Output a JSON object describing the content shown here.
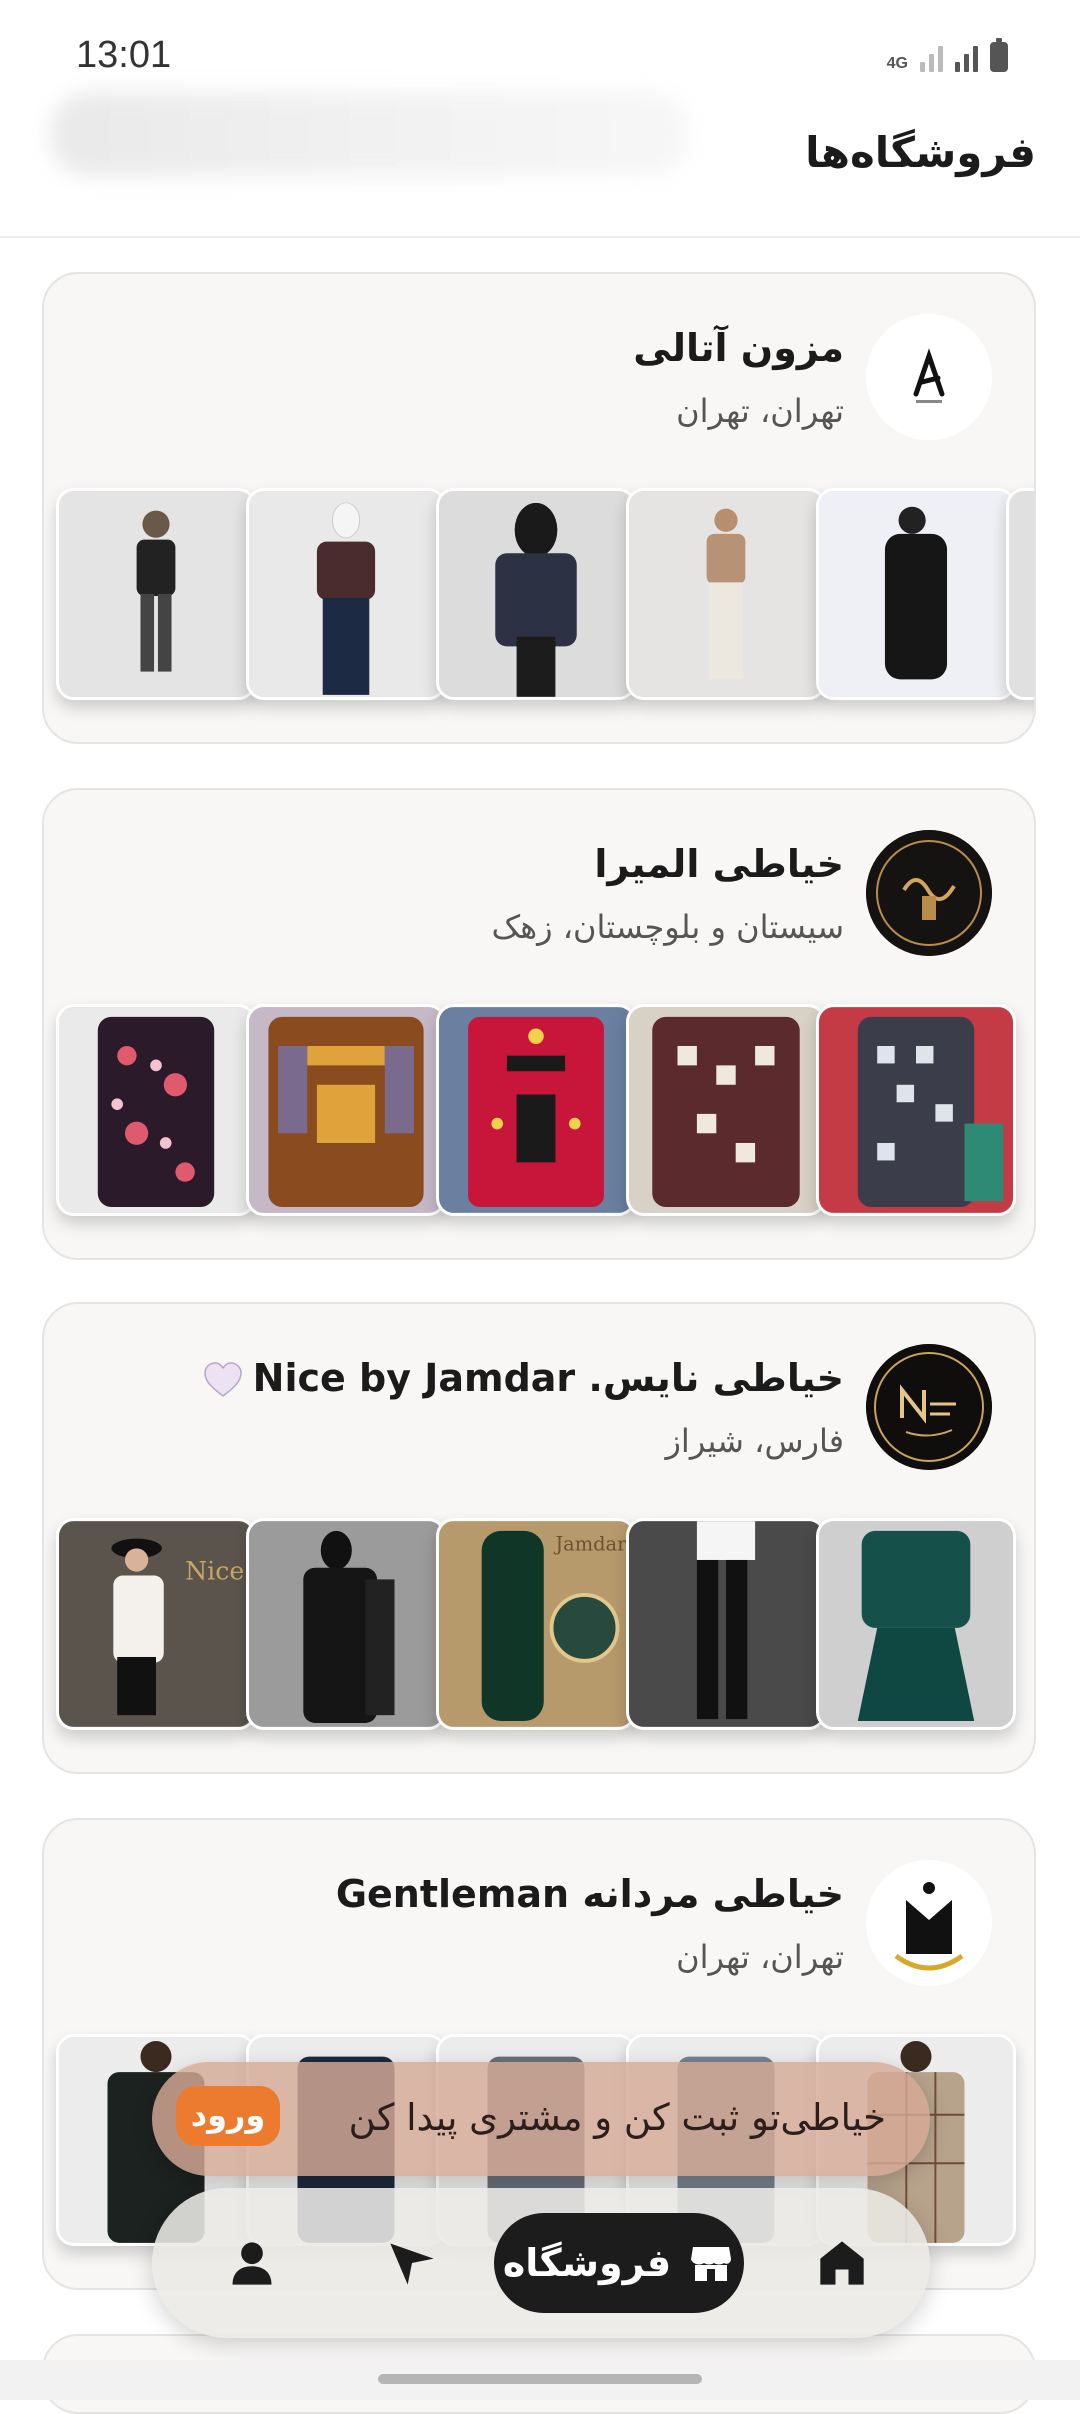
{
  "status_bar": {
    "time": "13:01",
    "network": "4G"
  },
  "header": {
    "title": "فروشگاه‌ها"
  },
  "stores": [
    {
      "name": "مزون آتالی",
      "location": "تهران، تهران",
      "logo": "atali-logo"
    },
    {
      "name": "خیاطی المیرا",
      "location": "سیستان و بلوچستان، زهک",
      "logo": "elmira-logo"
    },
    {
      "name": "خیاطی نایس. Nice by Jamdar",
      "location": "فارس، شیراز",
      "logo": "nice-logo",
      "emoji": "heart-icon"
    },
    {
      "name": "خیاطی مردانه Gentleman",
      "location": "تهران، تهران",
      "logo": "gentleman-logo"
    }
  ],
  "promo": {
    "text": "خیاطی‌تو ثبت کن و مشتری پیدا کن",
    "login_label": "ورود"
  },
  "nav": {
    "home_icon": "home-icon",
    "store_label": "فروشگاه",
    "store_icon": "store-icon",
    "send_icon": "send-icon",
    "profile_icon": "profile-icon"
  },
  "colors": {
    "accent": "#ec7b2f",
    "nav_active": "#1c1c1c",
    "card_bg": "#f8f7f6"
  }
}
